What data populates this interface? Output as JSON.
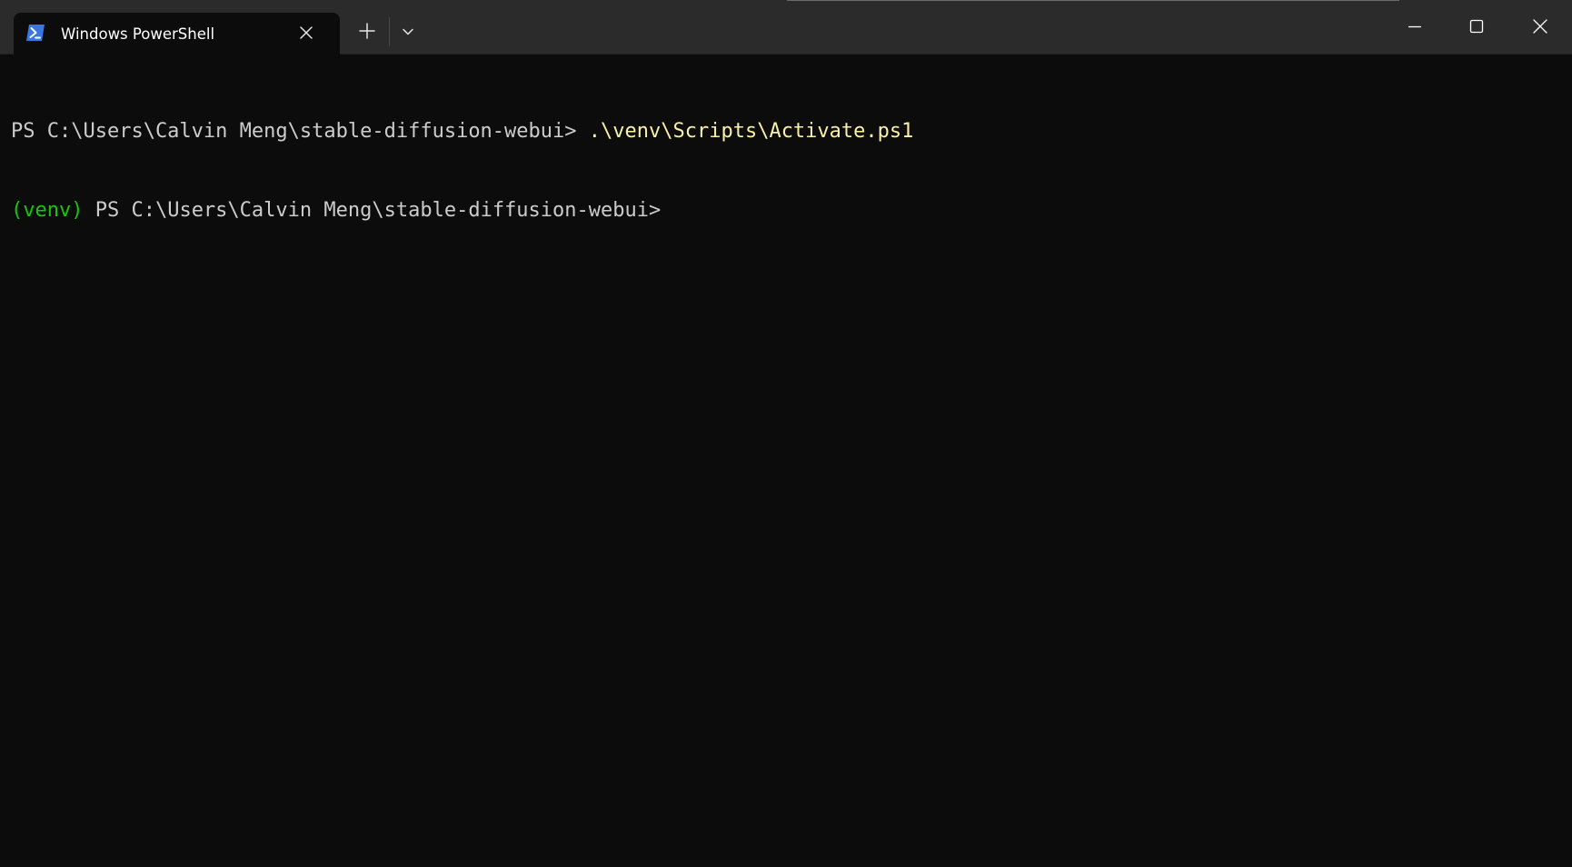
{
  "window": {
    "tab_title": "Windows PowerShell",
    "tab_icon": "powershell-icon",
    "new_tab_icon": "plus-icon",
    "dropdown_icon": "chevron-down-icon",
    "minimize_icon": "minimize-icon",
    "maximize_icon": "maximize-icon",
    "close_icon": "close-icon"
  },
  "terminal": {
    "lines": [
      {
        "prompt": "PS C:\\Users\\Calvin Meng\\stable-diffusion-webui> ",
        "command": ".\\venv\\Scripts\\Activate.ps1"
      },
      {
        "env": "(venv)",
        "prompt": " PS C:\\Users\\Calvin Meng\\stable-diffusion-webui>"
      }
    ]
  },
  "colors": {
    "background": "#0c0c0c",
    "titlebar": "#2b2b2b",
    "text": "#cccccc",
    "command": "#f9f1a5",
    "venv": "#16c60c",
    "ps_icon": "#2f6fd6"
  }
}
